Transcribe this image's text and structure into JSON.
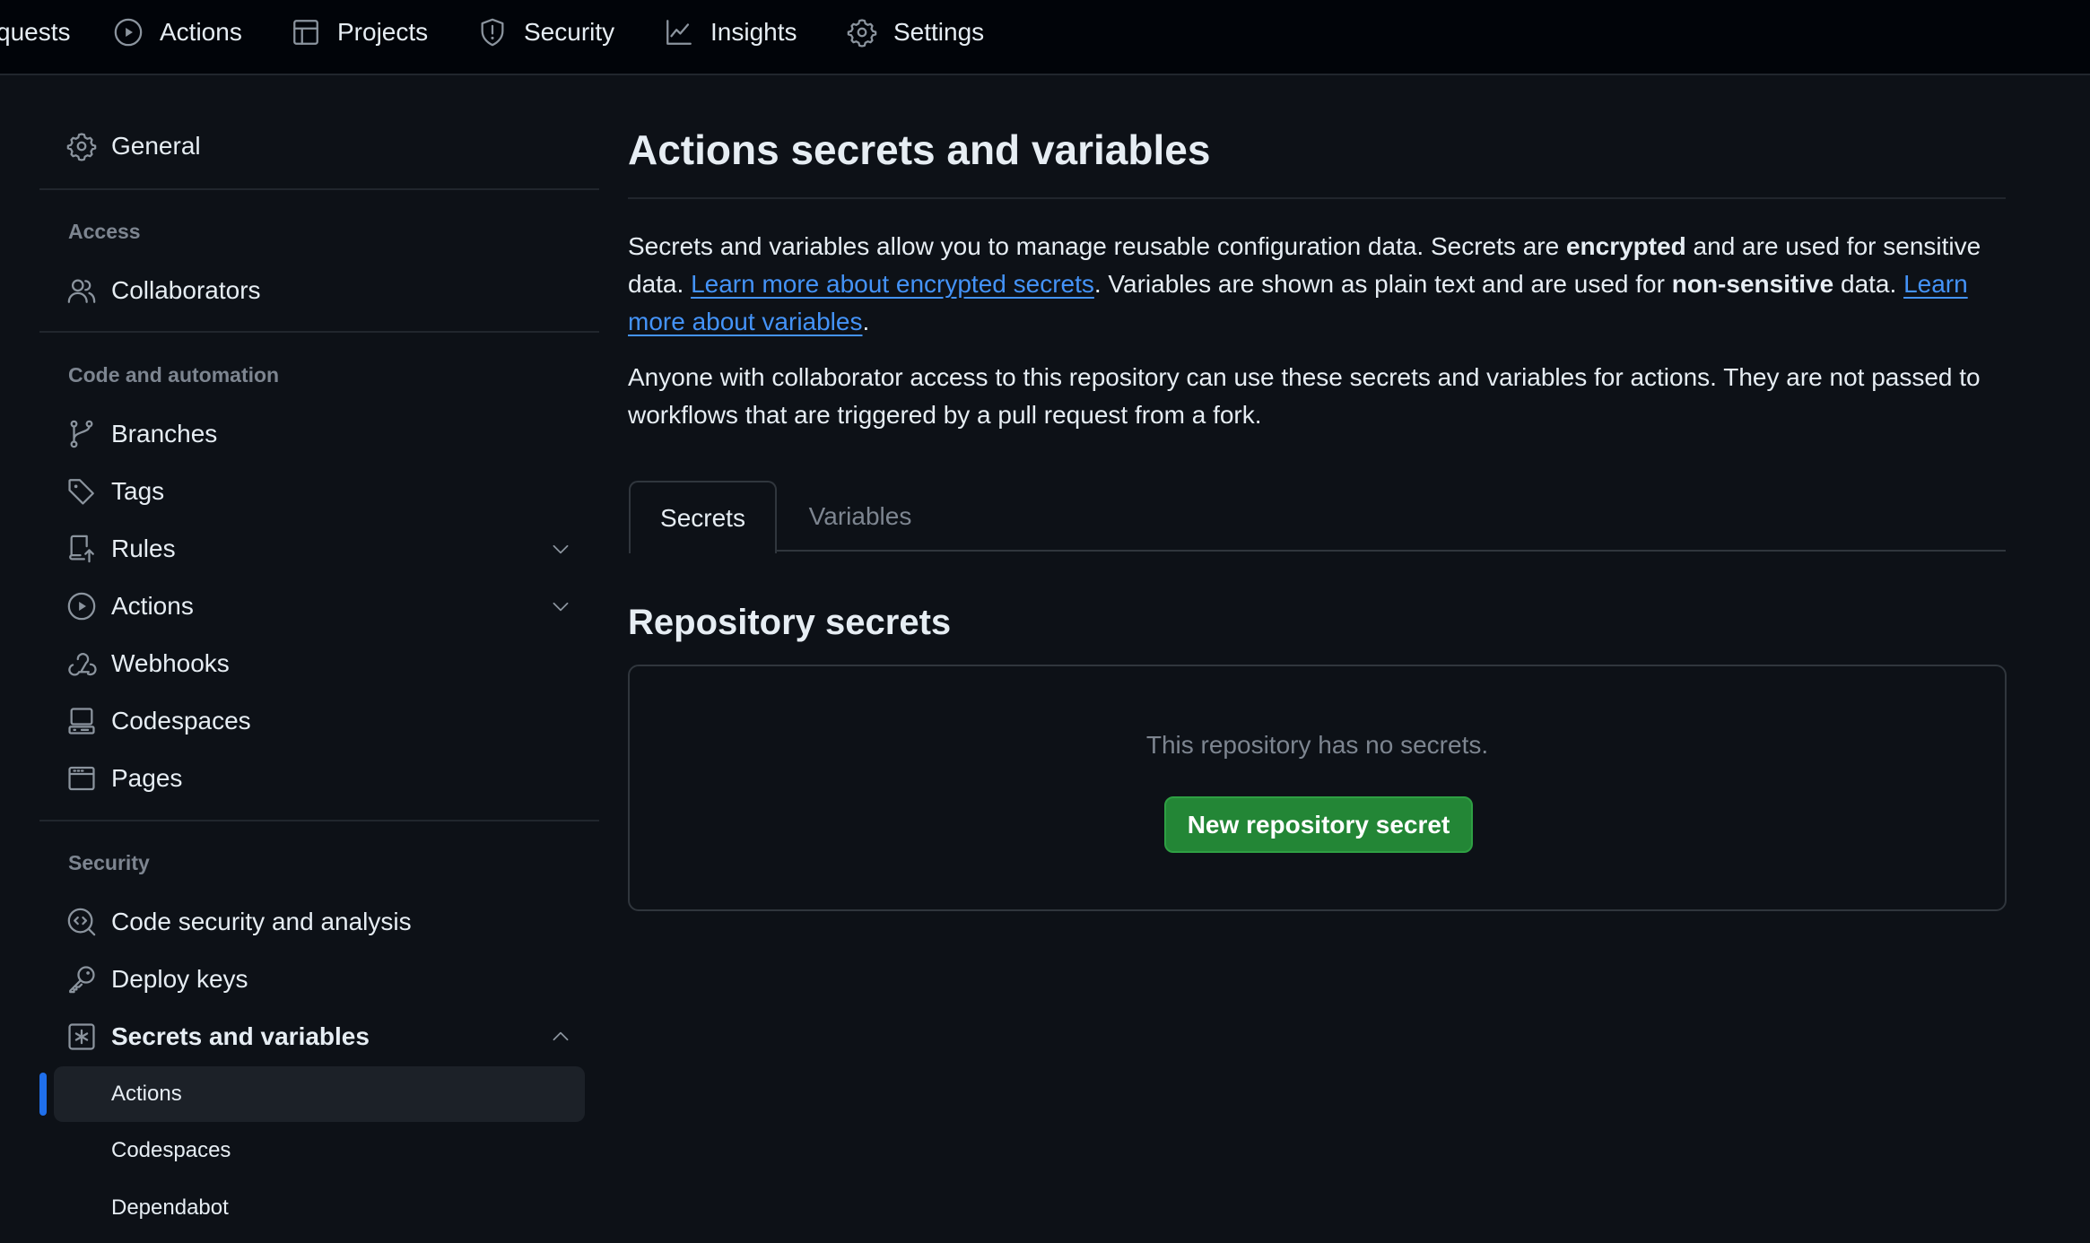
{
  "topnav": {
    "items": [
      {
        "label": "quests",
        "icon": "pull-request-icon"
      },
      {
        "label": "Actions",
        "icon": "play-icon"
      },
      {
        "label": "Projects",
        "icon": "table-icon"
      },
      {
        "label": "Security",
        "icon": "shield-icon"
      },
      {
        "label": "Insights",
        "icon": "graph-icon"
      },
      {
        "label": "Settings",
        "icon": "gear-icon"
      }
    ]
  },
  "sidebar": {
    "general": "General",
    "sections": {
      "access": "Access",
      "code_automation": "Code and automation",
      "security": "Security"
    },
    "items": {
      "collaborators": "Collaborators",
      "branches": "Branches",
      "tags": "Tags",
      "rules": "Rules",
      "actions": "Actions",
      "webhooks": "Webhooks",
      "codespaces": "Codespaces",
      "pages": "Pages",
      "code_security": "Code security and analysis",
      "deploy_keys": "Deploy keys",
      "secrets_variables": "Secrets and variables"
    },
    "sub_items": {
      "actions": "Actions",
      "codespaces": "Codespaces",
      "dependabot": "Dependabot"
    },
    "active": "Actions",
    "accent_color": "#1f6feb"
  },
  "main": {
    "title": "Actions secrets and variables",
    "intro": {
      "p1_a": "Secrets and variables allow you to manage reusable configuration data. Secrets are ",
      "p1_bold1": "encrypted",
      "p1_b": " and are used for sensitive data. ",
      "link_secrets": "Learn more about encrypted secrets",
      "p1_c": ". Variables are shown as plain text and are used for ",
      "p1_bold2": "non-sensitive",
      "p1_d": " data. ",
      "link_variables": "Learn more about variables",
      "p1_e": "."
    },
    "access_note": "Anyone with collaborator access to this repository can use these secrets and variables for actions. They are not passed to workflows that are triggered by a pull request from a fork.",
    "tabs": [
      {
        "label": "Secrets",
        "selected": true
      },
      {
        "label": "Variables",
        "selected": false
      }
    ],
    "repo_secrets_heading": "Repository secrets",
    "empty_state": "This repository has no secrets.",
    "new_secret_button": "New repository secret",
    "button_color": "#238636",
    "link_color": "#4493f8"
  }
}
